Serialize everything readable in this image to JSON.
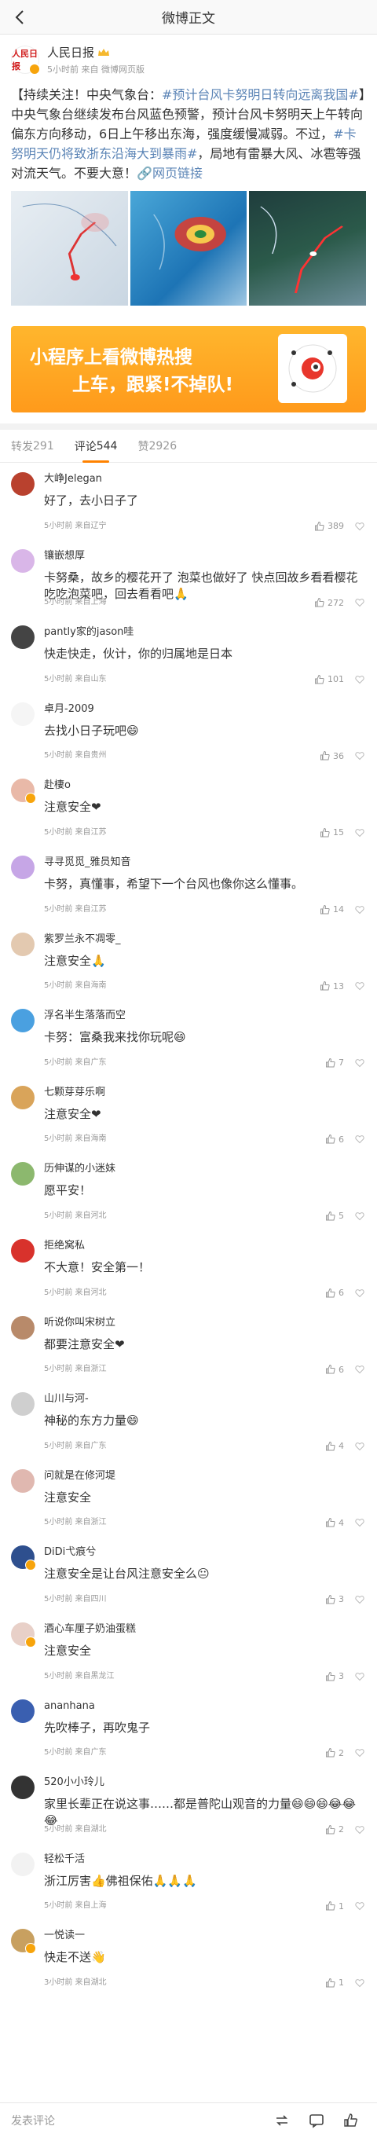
{
  "nav": {
    "title": "微博正文"
  },
  "post": {
    "author": "人民日报",
    "avatar_text": "人民日报",
    "sub": "5小时前 来自 微博网页版",
    "text_prefix": "【持续关注！中央气象台：",
    "topic1": "#预计台风卡努明日转向远离我国#",
    "text_mid": "】中央气象台继续发布台风蓝色预警，预计台风卡努明天上午转向偏东方向移动，6日上午移出东海，强度缓慢减弱。不过，",
    "topic2": "#卡努明天仍将致浙东沿海大到暴雨#",
    "text_end": "，局地有雷暴大风、冰雹等强对流天气。不要大意！",
    "link": "网页链接"
  },
  "banner": {
    "line1": "小程序上看微博热搜",
    "line2": "上车，跟紧!不掉队!"
  },
  "tabs": [
    {
      "label": "转发",
      "count": "291"
    },
    {
      "label": "评论",
      "count": "544"
    },
    {
      "label": "赞",
      "count": "2926"
    }
  ],
  "comments": [
    {
      "name": "大峥Jelegan",
      "text": "好了，去小日子了",
      "time": "5小时前 来自辽宁",
      "likes": "389",
      "avatar_color": "#b9412e",
      "badge": ""
    },
    {
      "name": "镶嵌想厚",
      "text": "卡努桑，故乡的樱花开了 泡菜也做好了 快点回故乡看看樱花吃吃泡菜吧，回去看看吧🙏",
      "time": "5小时前 来自上海",
      "likes": "272",
      "avatar_color": "#d9b6e8",
      "badge": ""
    },
    {
      "name": "pantly家的jason哇",
      "text": "快走快走，伙计，你的归属地是日本",
      "time": "5小时前 来自山东",
      "likes": "101",
      "avatar_color": "#444",
      "badge": ""
    },
    {
      "name": "卓月-2009",
      "text": "去找小日子玩吧😄",
      "time": "5小时前 来自贵州",
      "likes": "36",
      "avatar_color": "#f5f5f5",
      "badge": ""
    },
    {
      "name": "赴棲o",
      "text": "注意安全❤",
      "time": "5小时前 来自江苏",
      "likes": "15",
      "avatar_color": "#e9b9a8",
      "badge": "orange"
    },
    {
      "name": "寻寻觅觅_雅员知音",
      "text": "卡努，真懂事，希望下一个台风也像你这么懂事。",
      "time": "5小时前 来自江苏",
      "likes": "14",
      "avatar_color": "#c6a6e6",
      "badge": ""
    },
    {
      "name": "紫罗兰永不凋零_",
      "text": "注意安全🙏",
      "time": "5小时前 来自海南",
      "likes": "13",
      "avatar_color": "#e3c9b0",
      "badge": ""
    },
    {
      "name": "浮名半生落落而空",
      "text": "卡努：富桑我来找你玩呢😄",
      "time": "5小时前 来自广东",
      "likes": "7",
      "avatar_color": "#4aa0e0",
      "badge": ""
    },
    {
      "name": "七颗芽芽乐啊",
      "text": "注意安全❤",
      "time": "5小时前 来自海南",
      "likes": "6",
      "avatar_color": "#d9a45a",
      "badge": ""
    },
    {
      "name": "历伸谋的小迷妹",
      "text": "愿平安！",
      "time": "5小时前 来自河北",
      "likes": "5",
      "avatar_color": "#8cb86e",
      "badge": ""
    },
    {
      "name": "拒绝窝私",
      "text": "不大意！安全第一！",
      "time": "5小时前 来自河北",
      "likes": "6",
      "avatar_color": "#d8322c",
      "badge": ""
    },
    {
      "name": "听说你叫宋树立",
      "text": "都要注意安全❤",
      "time": "5小时前 来自浙江",
      "likes": "6",
      "avatar_color": "#b88a6a",
      "badge": ""
    },
    {
      "name": "山川与河-",
      "text": "神秘的东方力量😄",
      "time": "5小时前 来自广东",
      "likes": "4",
      "avatar_color": "#cfcfcf",
      "badge": ""
    },
    {
      "name": "问就是在修河堤",
      "text": "注意安全",
      "time": "5小时前 来自浙江",
      "likes": "4",
      "avatar_color": "#e0b8b0",
      "badge": ""
    },
    {
      "name": "DiDi弋痕兮",
      "text": "注意安全是让台风注意安全么😐",
      "time": "5小时前 来自四川",
      "likes": "3",
      "avatar_color": "#2e4f8e",
      "badge": "orange"
    },
    {
      "name": "酒心车厘子奶油蛋糕",
      "text": "注意安全",
      "time": "5小时前 来自黑龙江",
      "likes": "3",
      "avatar_color": "#e8d0c8",
      "badge": "orange"
    },
    {
      "name": "ananhana",
      "text": "先吹棒子，再吹鬼子",
      "time": "5小时前 来自广东",
      "likes": "2",
      "avatar_color": "#3a5fb0",
      "badge": ""
    },
    {
      "name": "520小小玲儿",
      "text": "家里长辈正在说这事……都是普陀山观音的力量😄😄😄😂😂😂",
      "time": "5小时前 来自湖北",
      "likes": "2",
      "avatar_color": "#333",
      "badge": ""
    },
    {
      "name": "轻松千活",
      "text": "浙江厉害👍佛祖保佑🙏🙏🙏",
      "time": "5小时前 来自上海",
      "likes": "1",
      "avatar_color": "#f2f2f2",
      "badge": ""
    },
    {
      "name": "一悦读一",
      "text": "快走不送👋",
      "time": "3小时前 来自湖北",
      "likes": "1",
      "avatar_color": "#c8a060",
      "badge": "orange"
    }
  ],
  "bottombar": {
    "placeholder": "发表评论"
  }
}
